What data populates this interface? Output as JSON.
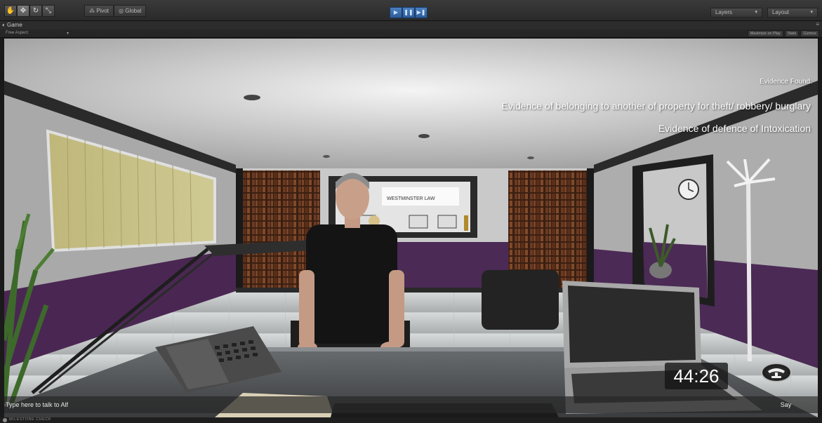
{
  "toolbar": {
    "pivot_label": "Pivot",
    "global_label": "Global",
    "layers_label": "Layers",
    "layout_label": "Layout"
  },
  "game_tab": {
    "title": "Game",
    "aspect": "Free Aspect",
    "options": [
      "Maximize on Play",
      "Stats",
      "Gizmos"
    ]
  },
  "hud": {
    "evidence_heading": "Evidence Found:",
    "evidence_items": [
      "Evidence of belonging to another of property for theft/ robbery/ burglary",
      "Evidence of defence of Intoxication"
    ],
    "timer": "44:26",
    "sign_text": "WESTMINSTER LAW"
  },
  "chat": {
    "placeholder": "Type here to talk to Alf",
    "say_label": "Say"
  },
  "status": {
    "text": "MILESTONE CHECK"
  },
  "colors": {
    "accent_play": "#3d6fb0",
    "wall_purple": "#4b2a55",
    "hud_text": "#ffffff"
  }
}
